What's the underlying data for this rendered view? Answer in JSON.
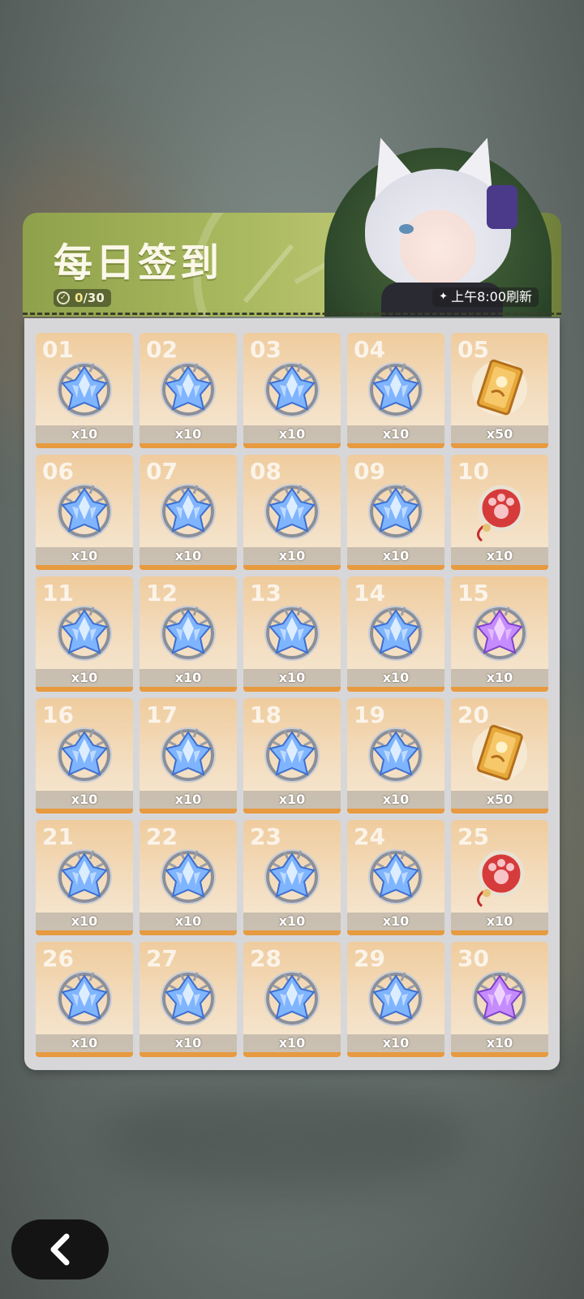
{
  "header": {
    "title": "每日签到",
    "progress": {
      "current": "0",
      "total": "/30"
    },
    "refresh_label": "上午8:00刷新"
  },
  "rewards": [
    {
      "day": "01",
      "qty": "x10",
      "item": "crystal-blue"
    },
    {
      "day": "02",
      "qty": "x10",
      "item": "crystal-blue"
    },
    {
      "day": "03",
      "qty": "x10",
      "item": "crystal-blue"
    },
    {
      "day": "04",
      "qty": "x10",
      "item": "crystal-blue"
    },
    {
      "day": "05",
      "qty": "x50",
      "item": "gold-card"
    },
    {
      "day": "06",
      "qty": "x10",
      "item": "crystal-blue"
    },
    {
      "day": "07",
      "qty": "x10",
      "item": "crystal-blue"
    },
    {
      "day": "08",
      "qty": "x10",
      "item": "crystal-blue"
    },
    {
      "day": "09",
      "qty": "x10",
      "item": "crystal-blue"
    },
    {
      "day": "10",
      "qty": "x10",
      "item": "paw-charm"
    },
    {
      "day": "11",
      "qty": "x10",
      "item": "crystal-blue"
    },
    {
      "day": "12",
      "qty": "x10",
      "item": "crystal-blue"
    },
    {
      "day": "13",
      "qty": "x10",
      "item": "crystal-blue"
    },
    {
      "day": "14",
      "qty": "x10",
      "item": "crystal-blue"
    },
    {
      "day": "15",
      "qty": "x10",
      "item": "crystal-purple"
    },
    {
      "day": "16",
      "qty": "x10",
      "item": "crystal-blue"
    },
    {
      "day": "17",
      "qty": "x10",
      "item": "crystal-blue"
    },
    {
      "day": "18",
      "qty": "x10",
      "item": "crystal-blue"
    },
    {
      "day": "19",
      "qty": "x10",
      "item": "crystal-blue"
    },
    {
      "day": "20",
      "qty": "x50",
      "item": "gold-card"
    },
    {
      "day": "21",
      "qty": "x10",
      "item": "crystal-blue"
    },
    {
      "day": "22",
      "qty": "x10",
      "item": "crystal-blue"
    },
    {
      "day": "23",
      "qty": "x10",
      "item": "crystal-blue"
    },
    {
      "day": "24",
      "qty": "x10",
      "item": "crystal-blue"
    },
    {
      "day": "25",
      "qty": "x10",
      "item": "paw-charm"
    },
    {
      "day": "26",
      "qty": "x10",
      "item": "crystal-blue"
    },
    {
      "day": "27",
      "qty": "x10",
      "item": "crystal-blue"
    },
    {
      "day": "28",
      "qty": "x10",
      "item": "crystal-blue"
    },
    {
      "day": "29",
      "qty": "x10",
      "item": "crystal-blue"
    },
    {
      "day": "30",
      "qty": "x10",
      "item": "crystal-purple"
    }
  ],
  "icons": {
    "back": "chevron-left-icon",
    "progress": "check-circle-icon",
    "refresh": "sparkle-icon"
  },
  "colors": {
    "banner_green": "#a9b95f",
    "cell_bg": "#f3dcbd",
    "cell_bar": "#e79a3f",
    "crystal_blue": "#7fb4ff",
    "crystal_purple": "#c58bff"
  }
}
